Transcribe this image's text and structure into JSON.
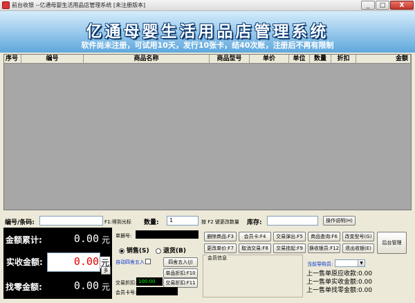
{
  "window": {
    "title": "前台收银 --亿通母婴生活用品店管理系统 [未注册版本]",
    "min": "_",
    "max": "□",
    "close": "X"
  },
  "banner": {
    "title": "亿通母婴生活用品店管理系统",
    "notice": "软件尚未注册，可试用10天，发行10张卡，结40次账，注册后不再有限制"
  },
  "table": {
    "columns": [
      "序号",
      "编号",
      "商品名称",
      "商品型号",
      "单价",
      "单位",
      "数量",
      "折扣",
      "金额"
    ]
  },
  "entry": {
    "code_label": "编号/条码:",
    "f1_hint": "F1:得到光标",
    "qty_label": "数量:",
    "qty_value": "1",
    "f2_hint": "按 F2 键更改数量",
    "stock_label": "库存:",
    "help_button": "操作说明(H)"
  },
  "summary": {
    "total_label": "金额累计:",
    "total_value": "0.00",
    "paid_label": "实收金额:",
    "paid_value": "0.00",
    "change_label": "找零金额:",
    "change_value": "0.00",
    "currency": "元",
    "more": "多"
  },
  "sale": {
    "receipt_label": "单据号:",
    "sale_option": "销售(S)",
    "return_option": "退货(B)",
    "auto_round_label": "自动四舍五入",
    "round_button": "四舍五入(J)",
    "item_discount_button": "单品折扣:F10",
    "deal_discount_label": "交易折扣:",
    "deal_discount_value": "100.00",
    "deal_discount_button": "交易折扣:F11",
    "member_card_label": "会员卡号:"
  },
  "functions": {
    "delete_item": "删除商品:F3",
    "member_card": "会员卡:F4",
    "pop_deal": "交易弹出:F5",
    "query_item": "商品查询:F6",
    "change_model": "改变型号(G)",
    "change_price": "更改单价:F7",
    "cancel_deal": "取消交易:F8",
    "hang_deal": "交易挂起:F9",
    "switch_cashier": "换收银员:F12",
    "exit_cashier": "退出收银(E)",
    "backend": "后台管理"
  },
  "member_panel": {
    "caption": "会员信息"
  },
  "guide": {
    "label": "当前导购员:"
  },
  "recent": {
    "last_receivable_label": "上一售单原应收款:",
    "last_receivable_value": "0.00",
    "last_received_label": "上一售单实收金额:",
    "last_received_value": "0.00",
    "last_change_label": "上一售单找零金额:",
    "last_change_value": "0.00"
  },
  "colors": {
    "banner_top": "#d6ecfb",
    "banner_bottom": "#5ea8dd",
    "grid_bg": "#a7a7a7",
    "paid_text": "#e00000",
    "discount_value": "#00ff00",
    "link_blue": "#0033cc"
  }
}
